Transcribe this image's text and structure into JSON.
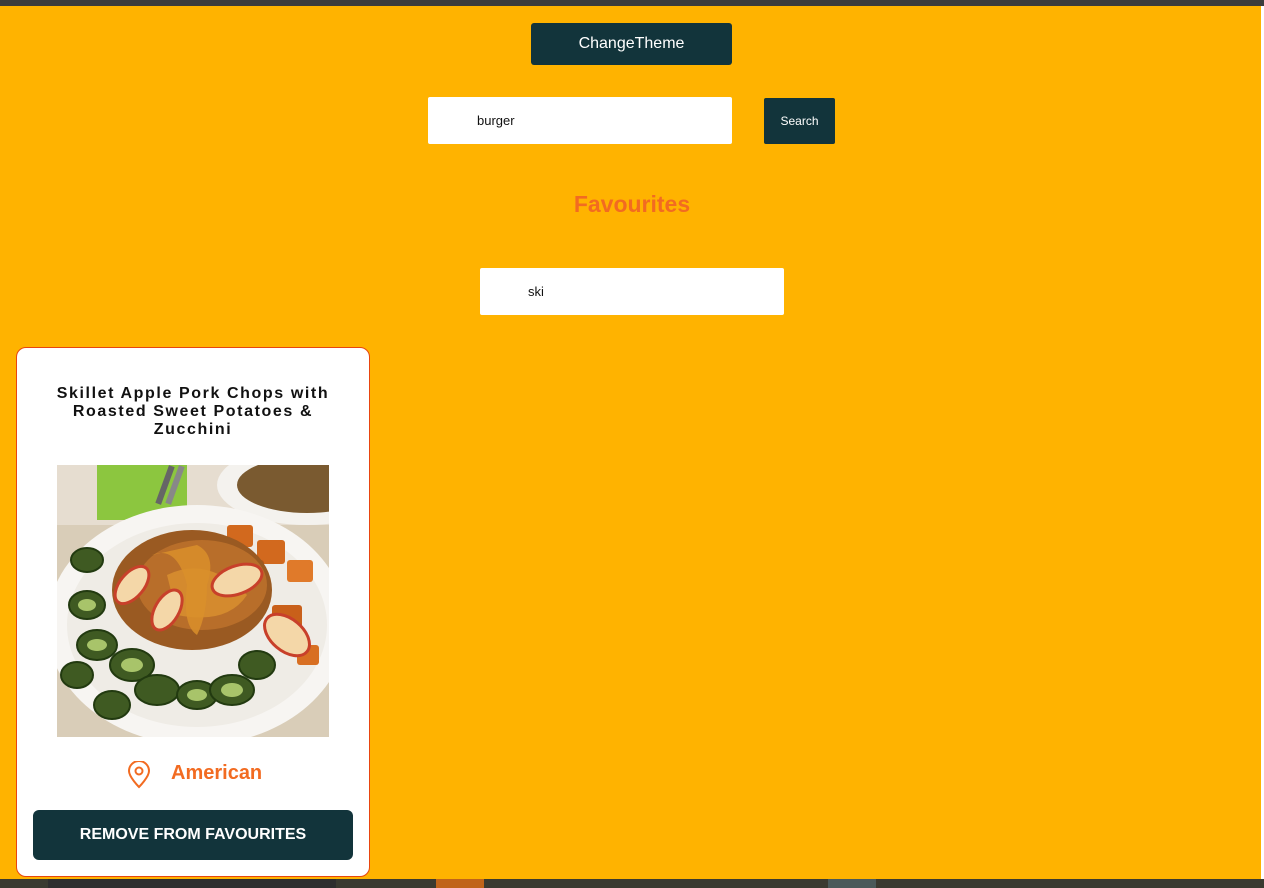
{
  "header": {
    "theme_button_label": "ChangeTheme"
  },
  "search": {
    "value": "burger",
    "button_label": "Search"
  },
  "favourites": {
    "heading": "Favourites",
    "filter_value": "ski",
    "cards": [
      {
        "title": "Skillet Apple Pork Chops with Roasted Sweet Potatoes & Zucchini",
        "image_icon": "food-photo",
        "cuisine_icon": "location-pin-icon",
        "cuisine": "American",
        "remove_label": "REMOVE FROM FAVOURITES"
      }
    ]
  },
  "colors": {
    "background": "#FFB300",
    "primary_dark": "#12343B",
    "accent_orange": "#F26B21",
    "card_border": "#E8450F"
  }
}
